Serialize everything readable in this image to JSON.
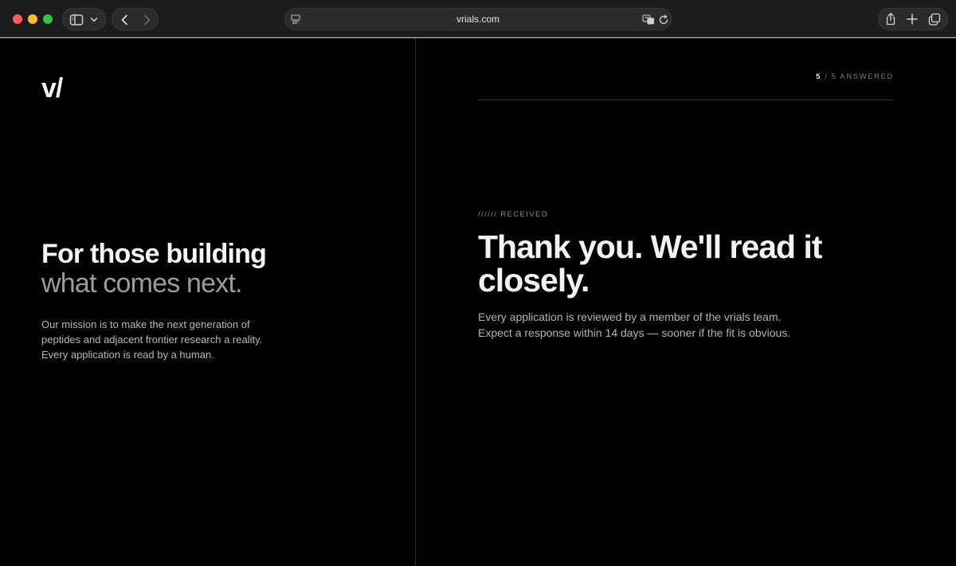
{
  "browser": {
    "url": "vrials.com",
    "icons": {
      "sidebar": "sidebar-icon",
      "sidebar_menu": "chevron-down-icon",
      "back": "chevron-left-icon",
      "forward": "chevron-right-icon",
      "page": "page-menu-icon",
      "translate": "translate-icon",
      "reload": "reload-icon",
      "share": "share-icon",
      "new_tab": "plus-icon",
      "tab_overview": "tabs-icon"
    }
  },
  "left": {
    "logo": "v/",
    "headline_line1": "For those building",
    "headline_line2": "what comes next.",
    "mission_line1": "Our mission is to make the next generation of",
    "mission_line2": "peptides and adjacent frontier research a reality.",
    "mission_line3": "Every application is read by a human."
  },
  "right": {
    "progress_current": "5",
    "progress_rest": "/ 5 ANSWERED",
    "kicker": "////// RECEIVED",
    "thanks_line1": "Thank you. We'll read it",
    "thanks_line2": "closely.",
    "body_line1": "Every application is reviewed by a member of the vrials team.",
    "body_line2": "Expect a response within 14 days — sooner if the fit is obvious."
  },
  "colors": {
    "background": "#000000",
    "toolbar": "#1c1c1e",
    "text_primary": "#f2f2f2",
    "text_muted": "#9c9c9c",
    "traffic_red": "#ff5f57",
    "traffic_yellow": "#febc2e",
    "traffic_green": "#28c840"
  }
}
